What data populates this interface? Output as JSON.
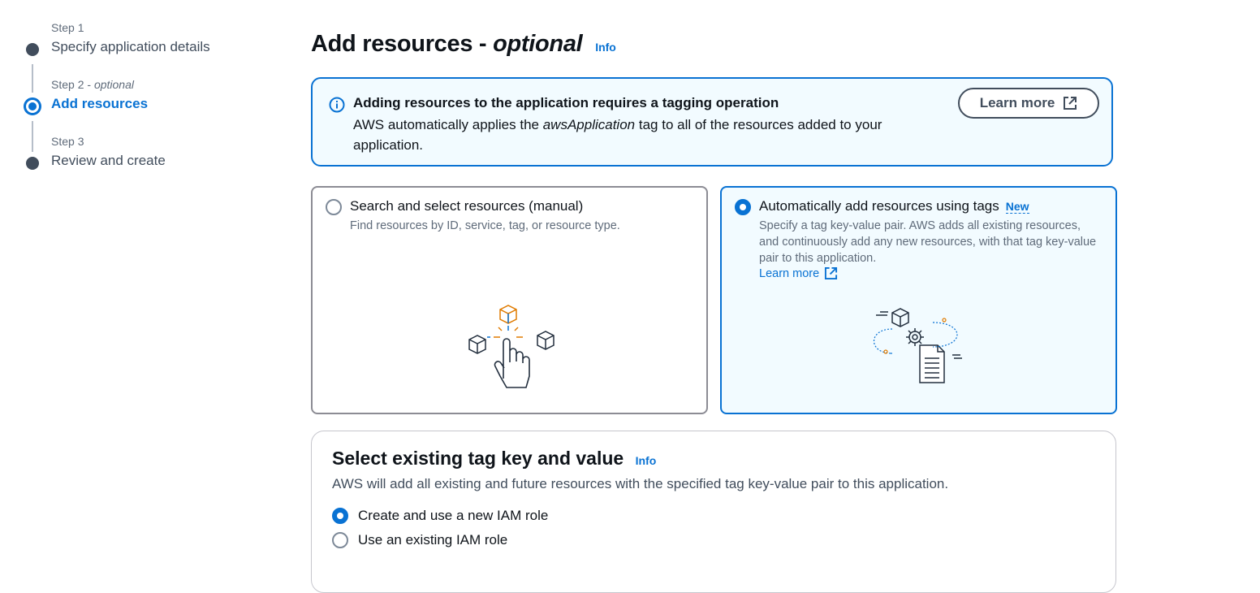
{
  "wizard": {
    "steps": [
      {
        "number": "Step 1",
        "title": "Specify application details"
      },
      {
        "number": "Step 2",
        "number_suffix": "optional",
        "title": "Add resources"
      },
      {
        "number": "Step 3",
        "title": "Review and create"
      }
    ]
  },
  "header": {
    "title": "Add resources -",
    "title_optional": "optional",
    "info": "Info"
  },
  "alert": {
    "heading": "Adding resources to the application requires a tagging operation",
    "body_prefix": "AWS automatically applies the",
    "body_tag": "awsApplication",
    "body_suffix": "tag to all of the resources added to your application.",
    "button_label": "Learn more"
  },
  "tiles": {
    "manual": {
      "label": "Search and select resources (manual)",
      "description": "Find resources by ID, service, tag, or resource type."
    },
    "tags": {
      "label": "Automatically add resources using tags",
      "badge": "New",
      "description": "Specify a tag key-value pair. AWS adds all existing resources, and continuously add any new resources, with that tag key-value pair to this application.",
      "learn_more": "Learn more"
    }
  },
  "tag_section": {
    "title": "Select existing tag key and value",
    "info": "Info",
    "description": "AWS will add all existing and future resources with the specified tag key-value pair to this application.",
    "options": [
      {
        "label": "Create and use a new IAM role",
        "selected": true
      },
      {
        "label": "Use an existing IAM role",
        "selected": false
      }
    ]
  },
  "colors": {
    "accent": "#0972d3",
    "selected_bg": "#f2fbff",
    "text": "#0f141a",
    "muted": "#5f6b7a"
  }
}
